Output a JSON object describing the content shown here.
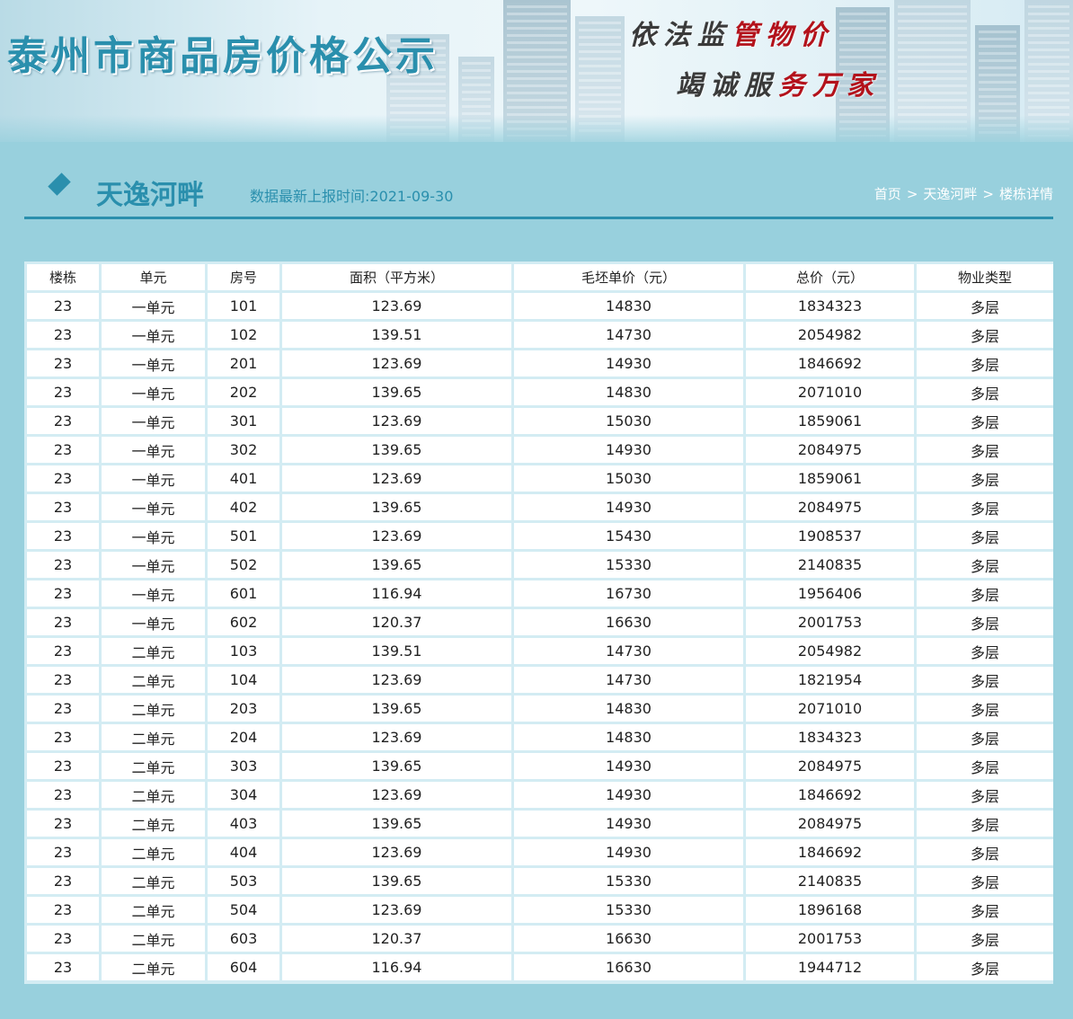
{
  "header": {
    "site_title": "泰州市商品房价格公示",
    "slogan_line1_a": "依法监",
    "slogan_line1_b": "管物价",
    "slogan_line2_a": "竭诚服",
    "slogan_line2_b": "务万家"
  },
  "page": {
    "project_name": "天逸河畔",
    "update_time": "数据最新上报时间:2021-09-30"
  },
  "breadcrumb": {
    "home": "首页",
    "sep": ">",
    "project": "天逸河畔",
    "current": "楼栋详情"
  },
  "table": {
    "headers": [
      "楼栋",
      "单元",
      "房号",
      "面积（平方米）",
      "毛坯单价（元）",
      "总价（元）",
      "物业类型"
    ],
    "rows": [
      [
        "23",
        "一单元",
        "101",
        "123.69",
        "14830",
        "1834323",
        "多层"
      ],
      [
        "23",
        "一单元",
        "102",
        "139.51",
        "14730",
        "2054982",
        "多层"
      ],
      [
        "23",
        "一单元",
        "201",
        "123.69",
        "14930",
        "1846692",
        "多层"
      ],
      [
        "23",
        "一单元",
        "202",
        "139.65",
        "14830",
        "2071010",
        "多层"
      ],
      [
        "23",
        "一单元",
        "301",
        "123.69",
        "15030",
        "1859061",
        "多层"
      ],
      [
        "23",
        "一单元",
        "302",
        "139.65",
        "14930",
        "2084975",
        "多层"
      ],
      [
        "23",
        "一单元",
        "401",
        "123.69",
        "15030",
        "1859061",
        "多层"
      ],
      [
        "23",
        "一单元",
        "402",
        "139.65",
        "14930",
        "2084975",
        "多层"
      ],
      [
        "23",
        "一单元",
        "501",
        "123.69",
        "15430",
        "1908537",
        "多层"
      ],
      [
        "23",
        "一单元",
        "502",
        "139.65",
        "15330",
        "2140835",
        "多层"
      ],
      [
        "23",
        "一单元",
        "601",
        "116.94",
        "16730",
        "1956406",
        "多层"
      ],
      [
        "23",
        "一单元",
        "602",
        "120.37",
        "16630",
        "2001753",
        "多层"
      ],
      [
        "23",
        "二单元",
        "103",
        "139.51",
        "14730",
        "2054982",
        "多层"
      ],
      [
        "23",
        "二单元",
        "104",
        "123.69",
        "14730",
        "1821954",
        "多层"
      ],
      [
        "23",
        "二单元",
        "203",
        "139.65",
        "14830",
        "2071010",
        "多层"
      ],
      [
        "23",
        "二单元",
        "204",
        "123.69",
        "14830",
        "1834323",
        "多层"
      ],
      [
        "23",
        "二单元",
        "303",
        "139.65",
        "14930",
        "2084975",
        "多层"
      ],
      [
        "23",
        "二单元",
        "304",
        "123.69",
        "14930",
        "1846692",
        "多层"
      ],
      [
        "23",
        "二单元",
        "403",
        "139.65",
        "14930",
        "2084975",
        "多层"
      ],
      [
        "23",
        "二单元",
        "404",
        "123.69",
        "14930",
        "1846692",
        "多层"
      ],
      [
        "23",
        "二单元",
        "503",
        "139.65",
        "15330",
        "2140835",
        "多层"
      ],
      [
        "23",
        "二单元",
        "504",
        "123.69",
        "15330",
        "1896168",
        "多层"
      ],
      [
        "23",
        "二单元",
        "603",
        "120.37",
        "16630",
        "2001753",
        "多层"
      ],
      [
        "23",
        "二单元",
        "604",
        "116.94",
        "16630",
        "1944712",
        "多层"
      ]
    ]
  },
  "colors": {
    "page_bg": "#98d0dd",
    "accent": "#2a8fad",
    "slogan_red": "#b3121b"
  }
}
